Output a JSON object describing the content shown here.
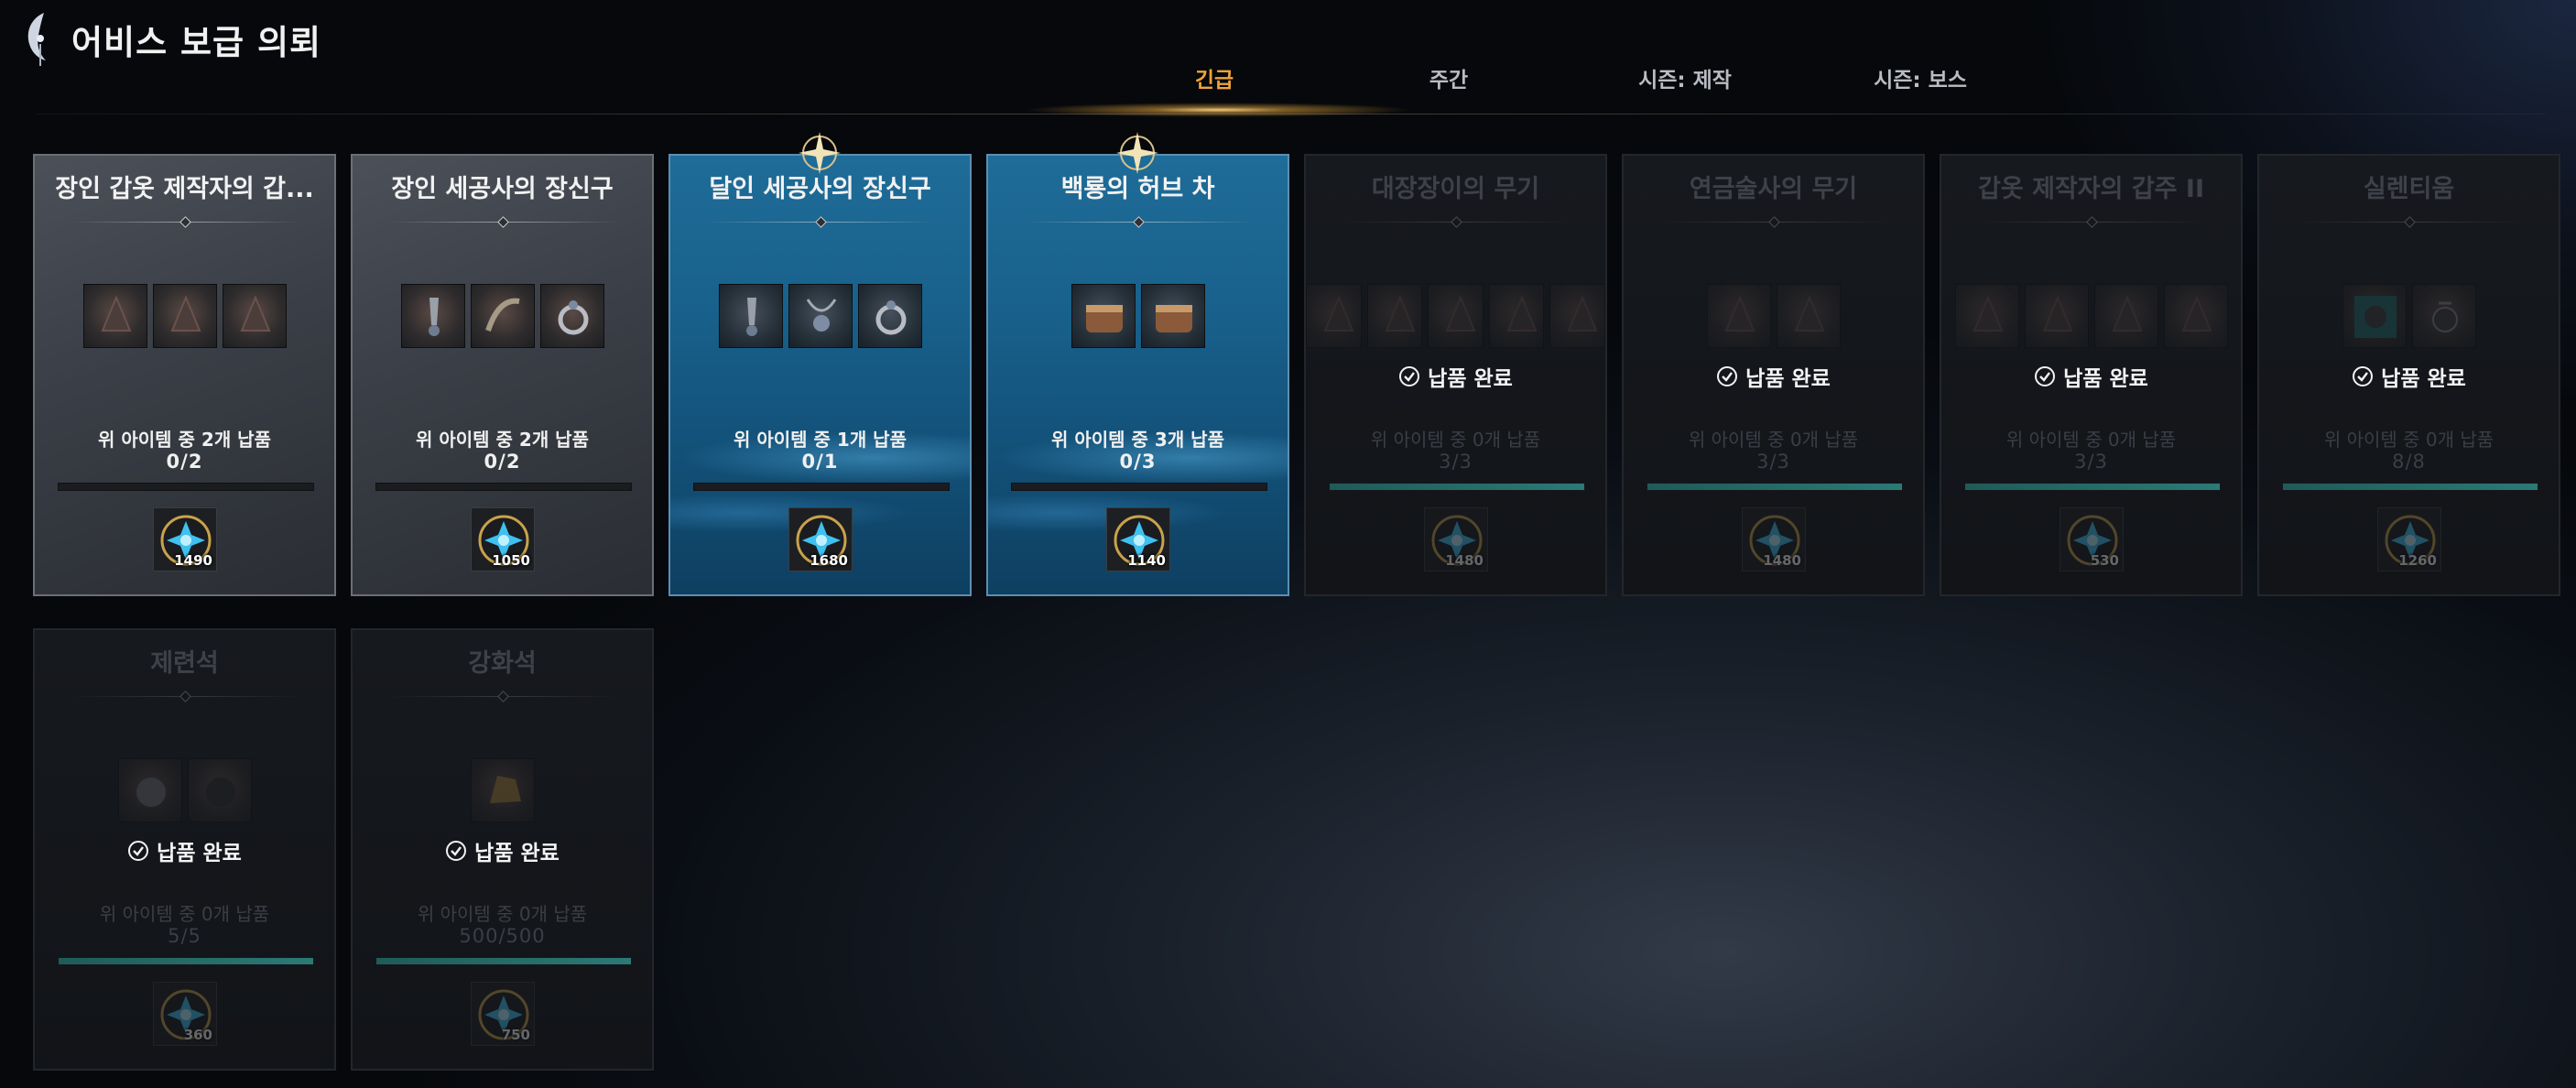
{
  "header": {
    "title": "어비스 보급 의뢰",
    "emblem_icon": "abyss-emblem-icon"
  },
  "tabs": [
    {
      "label": "긴급",
      "active": true
    },
    {
      "label": "주간",
      "active": false
    },
    {
      "label": "시즌: 제작",
      "active": false
    },
    {
      "label": "시즌: 보스",
      "active": false
    }
  ],
  "colors": {
    "active_tab": "#f0a33a",
    "highlight_card": "#1f6c98",
    "progress_fill": "#2f6d6a"
  },
  "cards": [
    {
      "title": "장인 갑옷 제작자의 갑...",
      "state": "normal",
      "items": [
        "armor-helm-icon",
        "armor-chest-icon",
        "armor-boots-icon"
      ],
      "requirement": "위 아이템 중 2개 납품",
      "progress": "0/2",
      "progress_fraction": 0,
      "reward_icon": "blue-gem-coin-icon",
      "reward_value": "1490"
    },
    {
      "title": "장인 세공사의 장신구",
      "state": "normal",
      "items": [
        "earring-icon",
        "horn-charm-icon",
        "ring-icon"
      ],
      "requirement": "위 아이템 중 2개 납품",
      "progress": "0/2",
      "progress_fraction": 0,
      "reward_icon": "blue-gem-coin-icon",
      "reward_value": "1050"
    },
    {
      "title": "달인 세공사의 장신구",
      "state": "highlight",
      "items": [
        "earring-icon",
        "amulet-icon",
        "ring-icon"
      ],
      "requirement": "위 아이템 중 1개 납품",
      "progress": "0/1",
      "progress_fraction": 0,
      "reward_icon": "blue-gem-coin-icon",
      "reward_value": "1680"
    },
    {
      "title": "백룡의 허브 차",
      "state": "highlight",
      "items": [
        "tea-cup-icon",
        "tea-cup-icon"
      ],
      "requirement": "위 아이템 중 3개 납품",
      "progress": "0/3",
      "progress_fraction": 0,
      "reward_icon": "blue-gem-coin-icon",
      "reward_value": "1140"
    },
    {
      "title": "대장장이의 무기",
      "state": "done",
      "done_label": "납품 완료",
      "items": [
        "sword-icon",
        "axe-icon",
        "spear-icon",
        "crossbow-icon",
        "dagger-icon"
      ],
      "requirement": "위 아이템 중 0개 납품",
      "progress": "3/3",
      "progress_fraction": 1,
      "reward_icon": "blue-gem-coin-icon",
      "reward_value": "1480"
    },
    {
      "title": "연금술사의 무기",
      "state": "done",
      "done_label": "납품 완료",
      "items": [
        "potion-flask-icon",
        "orb-icon"
      ],
      "requirement": "위 아이템 중 0개 납품",
      "progress": "3/3",
      "progress_fraction": 1,
      "reward_icon": "blue-gem-coin-icon",
      "reward_value": "1480"
    },
    {
      "title": "갑옷 제작자의 갑주 II",
      "state": "done",
      "done_label": "납품 완료",
      "items": [
        "gauntlet-icon",
        "greaves-icon",
        "boots-icon",
        "bracer-icon"
      ],
      "requirement": "위 아이템 중 0개 납품",
      "progress": "3/3",
      "progress_fraction": 1,
      "reward_icon": "blue-gem-coin-icon",
      "reward_value": "530"
    },
    {
      "title": "실렌티움",
      "state": "done",
      "done_label": "납품 완료",
      "items": [
        "teal-ore-icon",
        "pendant-icon"
      ],
      "requirement": "위 아이템 중 0개 납품",
      "progress": "8/8",
      "progress_fraction": 1,
      "reward_icon": "blue-gem-coin-icon",
      "reward_value": "1260"
    },
    {
      "title": "제련석",
      "state": "done",
      "done_label": "납품 완료",
      "items": [
        "gray-stone-icon",
        "dark-stone-icon"
      ],
      "requirement": "위 아이템 중 0개 납품",
      "progress": "5/5",
      "progress_fraction": 1,
      "reward_icon": "blue-gem-coin-icon",
      "reward_value": "360"
    },
    {
      "title": "강화석",
      "state": "done",
      "done_label": "납품 완료",
      "items": [
        "gold-stone-icon"
      ],
      "requirement": "위 아이템 중 0개 납품",
      "progress": "500/500",
      "progress_fraction": 1,
      "reward_icon": "blue-gem-coin-icon",
      "reward_value": "750"
    }
  ]
}
